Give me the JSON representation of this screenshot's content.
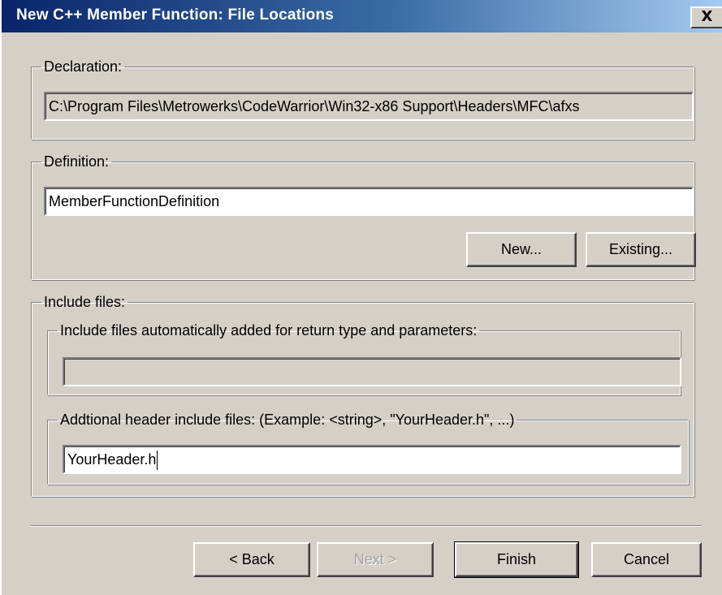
{
  "window": {
    "title": "New C++ Member Function: File Locations",
    "close_glyph": "X"
  },
  "declaration": {
    "legend": "Declaration:",
    "path": "C:\\Program Files\\Metrowerks\\CodeWarrior\\Win32-x86 Support\\Headers\\MFC\\afxs"
  },
  "definition": {
    "legend": "Definition:",
    "value": "MemberFunctionDefinition",
    "new_label": "New...",
    "existing_label": "Existing..."
  },
  "include_files": {
    "legend": "Include files:",
    "auto": {
      "legend": "Include files automatically added for return type and parameters:",
      "value": ""
    },
    "additional": {
      "legend": "Addtional header include files: (Example: <string>, \"YourHeader.h\", ...)",
      "value": "YourHeader.h"
    }
  },
  "footer": {
    "back_label": "< Back",
    "next_label": "Next >",
    "finish_label": "Finish",
    "cancel_label": "Cancel"
  },
  "colors": {
    "face": "#d4d0c8",
    "title_start": "#0a246a",
    "title_end": "#a6caf0",
    "disabled_text": "#a0a0a0"
  }
}
